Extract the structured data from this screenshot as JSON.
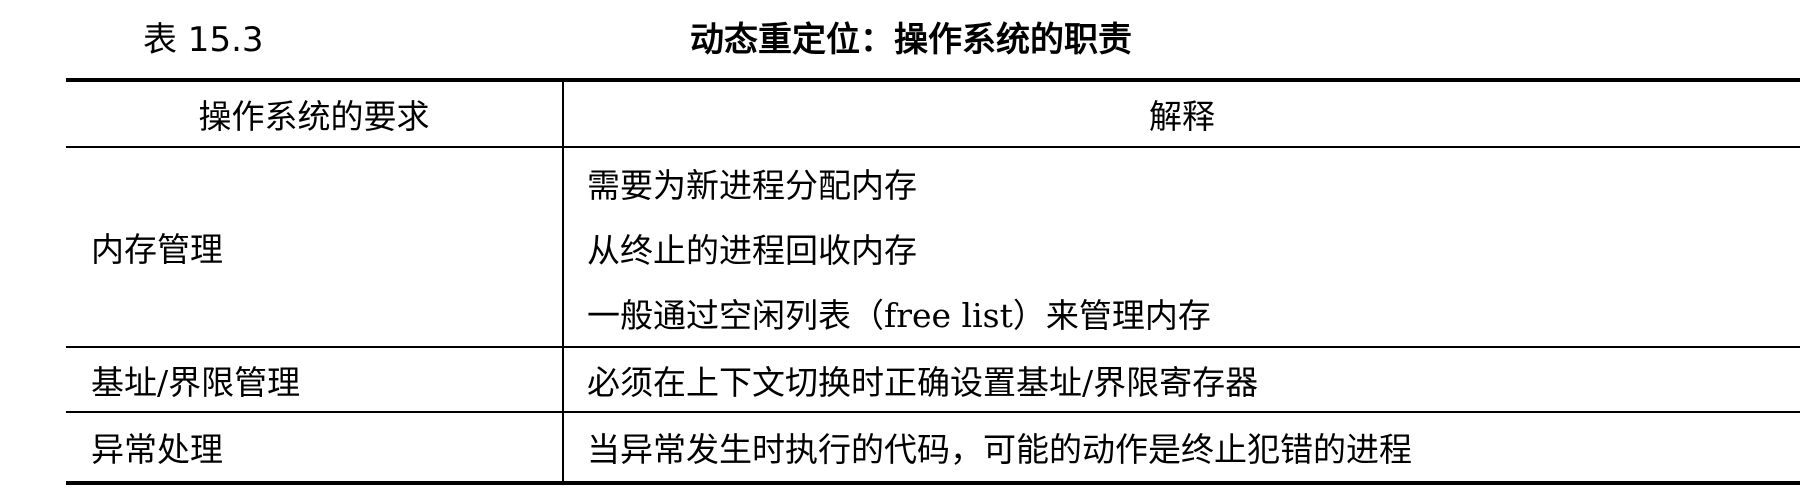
{
  "caption": {
    "number": "表 15.3",
    "title": "动态重定位：操作系统的职责"
  },
  "table": {
    "headers": [
      "操作系统的要求",
      "解释"
    ],
    "rows": [
      {
        "requirement": "内存管理",
        "explanation": [
          "需要为新进程分配内存",
          "从终止的进程回收内存",
          "一般通过空闲列表（free list）来管理内存"
        ]
      },
      {
        "requirement": "基址/界限管理",
        "explanation": [
          "必须在上下文切换时正确设置基址/界限寄存器"
        ]
      },
      {
        "requirement": "异常处理",
        "explanation": [
          "当异常发生时执行的代码，可能的动作是终止犯错的进程"
        ]
      }
    ]
  }
}
